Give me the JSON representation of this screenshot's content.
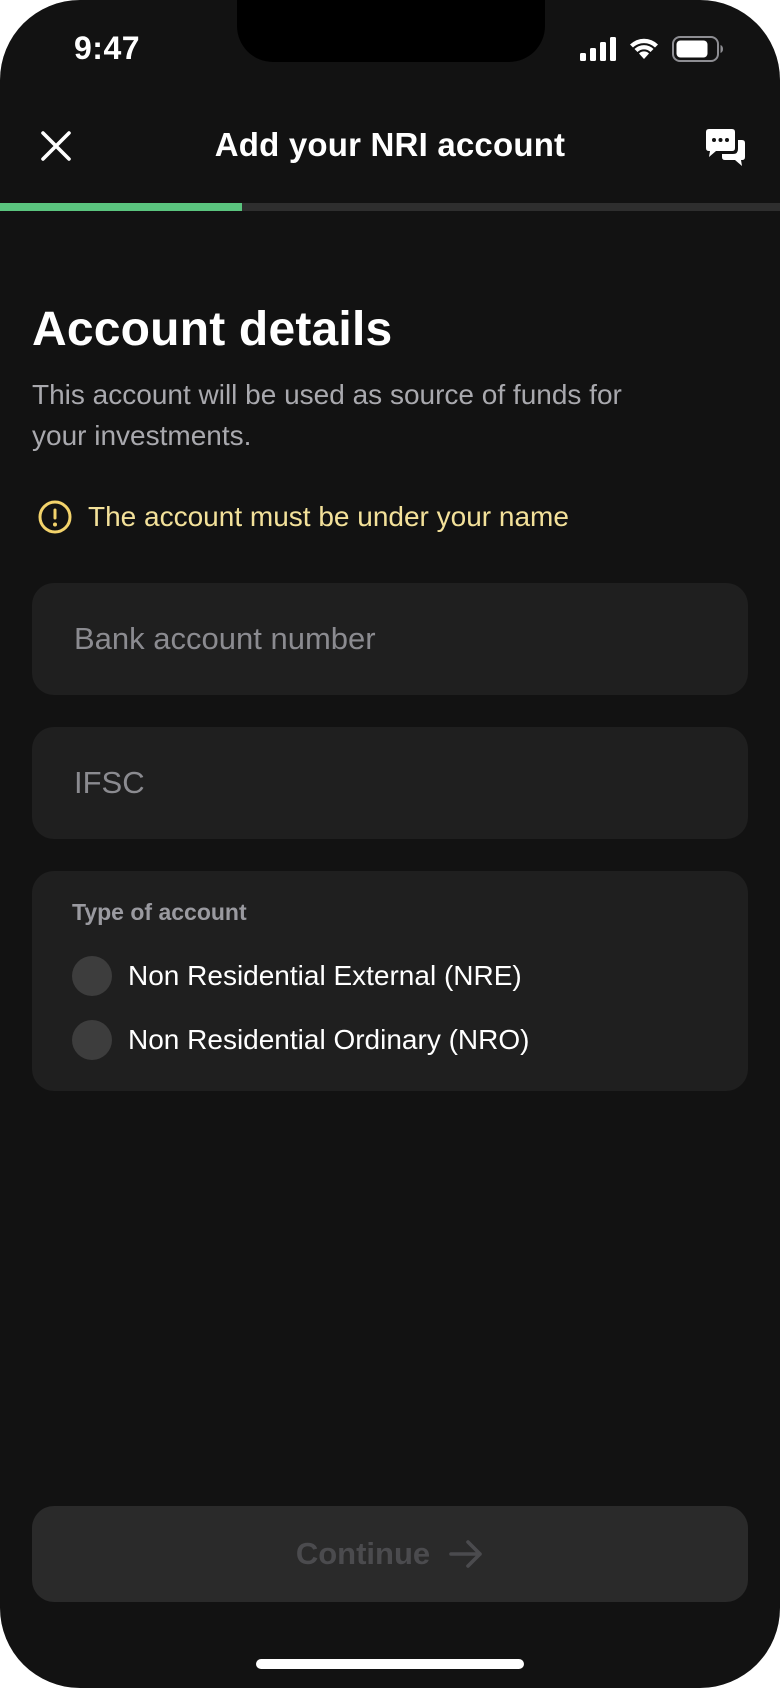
{
  "status_bar": {
    "time": "9:47",
    "icons": [
      "signal-icon",
      "wifi-icon",
      "battery-icon"
    ]
  },
  "header": {
    "title": "Add your NRI account",
    "close_icon": "close-icon",
    "chat_icon": "chat-icon"
  },
  "progress": {
    "fraction": 0.31,
    "fill_color": "#5ac47e",
    "track_color": "#2e2e2e"
  },
  "content": {
    "title": "Account details",
    "subtitle": "This account will be used as source of funds for your investments.",
    "warning": {
      "icon": "alert-circle-icon",
      "text": "The account must be under your name",
      "color": "#f3e19a"
    },
    "fields": {
      "bank_account": {
        "placeholder": "Bank account number",
        "value": ""
      },
      "ifsc": {
        "placeholder": "IFSC",
        "value": ""
      }
    },
    "account_type": {
      "label": "Type of account",
      "options": [
        {
          "label": "Non Residential External (NRE)",
          "selected": false
        },
        {
          "label": "Non Residential Ordinary (NRO)",
          "selected": false
        }
      ]
    }
  },
  "footer": {
    "continue_label": "Continue",
    "continue_icon": "arrow-right-icon",
    "enabled": false
  },
  "colors": {
    "background": "#121212",
    "surface": "#1f1f1f",
    "accent": "#5ac47e",
    "warning": "#f3e19a"
  }
}
